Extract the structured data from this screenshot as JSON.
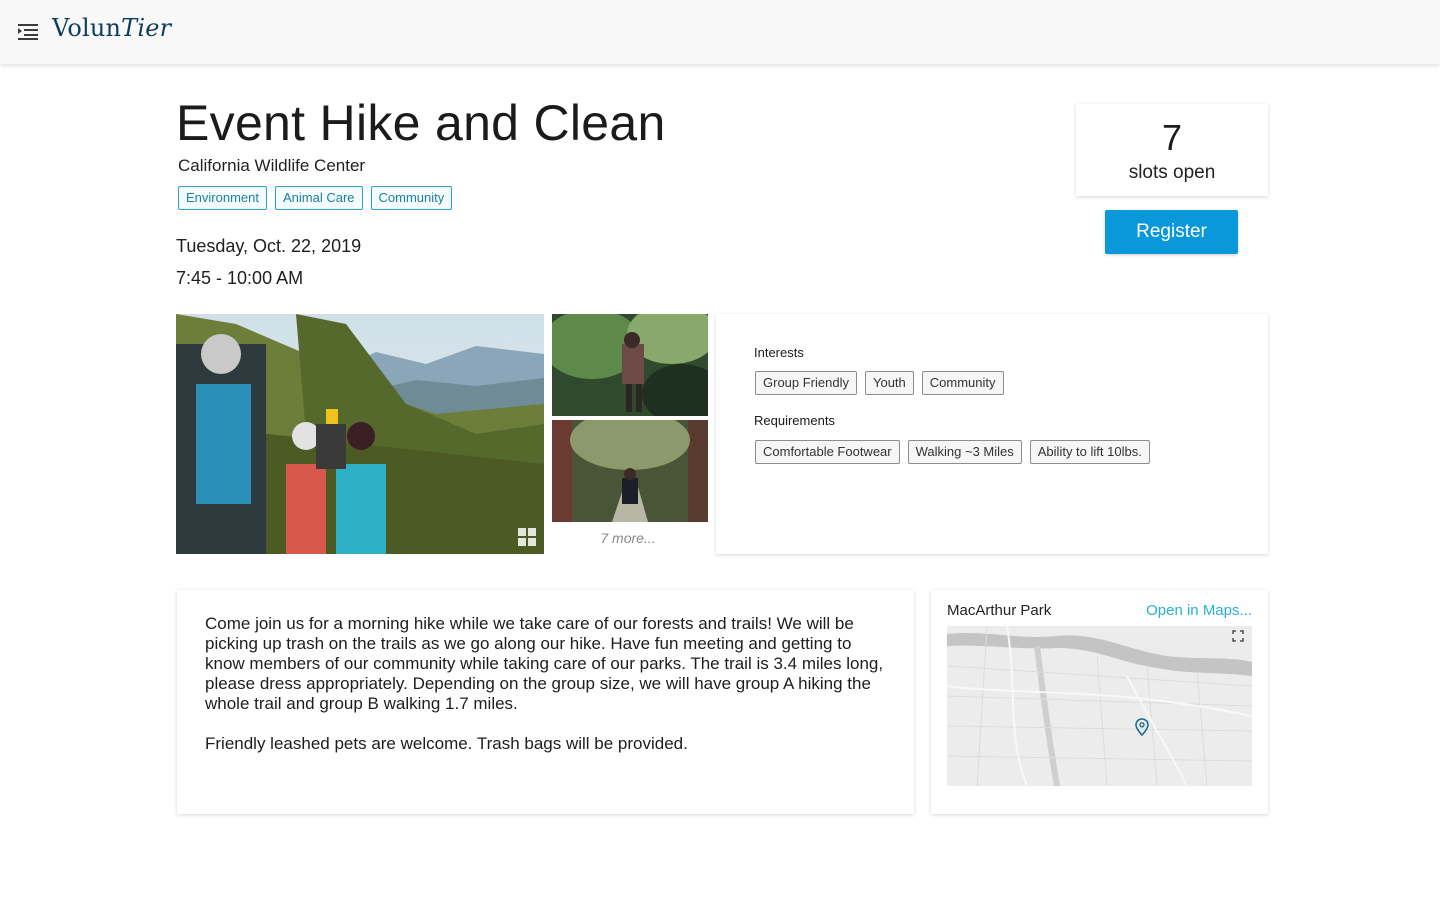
{
  "header": {
    "brand_part1": "Volun",
    "brand_part2": "Tier",
    "menu_icon": "menu-icon"
  },
  "event": {
    "title": "Event Hike and Clean",
    "organization": "California Wildlife Center",
    "categories": [
      "Environment",
      "Animal Care",
      "Community"
    ],
    "date": "Tuesday, Oct. 22, 2019",
    "time": "7:45 - 10:00 AM"
  },
  "slots": {
    "count": "7",
    "label": "slots open"
  },
  "register": {
    "label": "Register"
  },
  "gallery": {
    "more_label": "7 more...",
    "gallery_icon": "grid-icon"
  },
  "details": {
    "interests_heading": "Interests",
    "interests": [
      "Group Friendly",
      "Youth",
      "Community"
    ],
    "requirements_heading": "Requirements",
    "requirements": [
      "Comfortable Footwear",
      "Walking ~3 Miles",
      "Ability to lift 10lbs."
    ]
  },
  "description": {
    "paragraphs": [
      "Come join us for a morning hike while we take care of our forests and trails! We will be picking up trash on the trails as we go along our hike. Have fun meeting and getting to know members of our community while taking care of our parks. The trail is 3.4 miles long, please dress appropriately. Depending on the group size, we will have group A hiking the whole trail and group B walking 1.7 miles.",
      "Friendly leashed pets are welcome. Trash bags will be provided."
    ]
  },
  "map": {
    "place": "MacArthur Park",
    "open_link": "Open in Maps...",
    "expand_icon": "expand-icon",
    "pin_icon": "location-pin-icon"
  },
  "colors": {
    "brand": "#0e3d5e",
    "accent": "#0a98db",
    "tag_border": "#2ba3c9",
    "link": "#2ab0d6"
  }
}
